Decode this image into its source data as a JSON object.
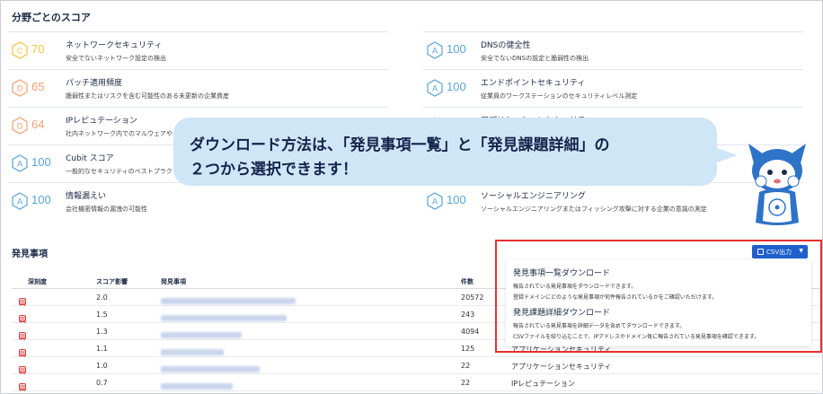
{
  "section_scores": {
    "title": "分野ごとのスコア",
    "left": [
      {
        "grade": "C",
        "score": "70",
        "title": "ネットワークセキュリティ",
        "desc": "安全でないネットワーク設定の検出",
        "color": "#f1c343"
      },
      {
        "grade": "D",
        "score": "65",
        "title": "パッチ適用頻度",
        "desc": "脆弱性またはリスクを含む可能性のある未更新の企業資産",
        "color": "#f0a070"
      },
      {
        "grade": "D",
        "score": "64",
        "title": "IPレピュテーション",
        "desc": "社内ネットワーク内でのマルウェアや",
        "color": "#f0a070"
      },
      {
        "grade": "A",
        "score": "100",
        "title": "Cubit スコア",
        "desc": "一般的なセキュリティのベストプラク",
        "color": "#5aa3d6"
      },
      {
        "grade": "A",
        "score": "100",
        "title": "情報漏えい",
        "desc": "会社機密情報の漏洩の可能性",
        "color": "#5aa3d6"
      }
    ],
    "right": [
      {
        "grade": "A",
        "score": "100",
        "title": "DNSの健全性",
        "desc": "安全でないDNSの設定と脆弱性の検出",
        "color": "#5aa3d6"
      },
      {
        "grade": "A",
        "score": "100",
        "title": "エンドポイントセキュリティ",
        "desc": "従業員のワークステーションのセキュリティレベル測定",
        "color": "#5aa3d6"
      },
      {
        "grade": "",
        "score": "",
        "title": "アプリケーションセキュリティ",
        "desc": "",
        "color": "#f1c343"
      },
      {
        "grade": "",
        "score": "",
        "title": "",
        "desc": "",
        "color": "#5aa3d6"
      },
      {
        "grade": "A",
        "score": "100",
        "title": "ソーシャルエンジニアリング",
        "desc": "ソーシャルエンジニアリングまたはフィッシング攻撃に対する企業の意識の測定",
        "color": "#5aa3d6"
      }
    ]
  },
  "findings": {
    "title": "発見事項",
    "headers": {
      "severity": "深刻度",
      "impact": "スコア影響",
      "finding": "発見事項",
      "count": "件数",
      "category": ""
    },
    "rows": [
      {
        "severity": "高",
        "impact": "2.0",
        "count": "20572",
        "category": "",
        "blur_w": 150
      },
      {
        "severity": "高",
        "impact": "1.5",
        "count": "243",
        "category": "",
        "blur_w": 140
      },
      {
        "severity": "高",
        "impact": "1.3",
        "count": "4094",
        "category": "",
        "blur_w": 90
      },
      {
        "severity": "高",
        "impact": "1.1",
        "count": "125",
        "category": "アプリケーションセキュリティ",
        "blur_w": 70
      },
      {
        "severity": "高",
        "impact": "1.0",
        "count": "22",
        "category": "アプリケーションセキュリティ",
        "blur_w": 110
      },
      {
        "severity": "高",
        "impact": "0.7",
        "count": "22",
        "category": "IPレピュテーション",
        "blur_w": 80
      }
    ]
  },
  "csv_button": {
    "label": "CSV出力"
  },
  "menu": {
    "item1": {
      "title": "発見事項一覧ダウンロード",
      "desc1": "報告されている発見事項をダウンロードできます。",
      "desc2": "登録ドメインにどのような発見事項が何件報告されているかをご確認いただけます。"
    },
    "item2": {
      "title": "発見課題詳細ダウンロード",
      "desc1": "報告されている発見事項を詳細データを含めてダウンロードできます。",
      "desc2": "CSVファイルを絞り込むことで、IPアドレスやドメイン毎に報告されている発見事項を確認できます。"
    }
  },
  "callout": {
    "line1": "ダウンロード方法は、「発見事項一覧」と「発見課題詳細」の",
    "line2": "２つから選択できます！"
  },
  "colors": {
    "accent": "#1e5fcc",
    "highlight": "#e53030",
    "bubble": "#cfe6f7",
    "severity_high": "#d93a3a"
  }
}
